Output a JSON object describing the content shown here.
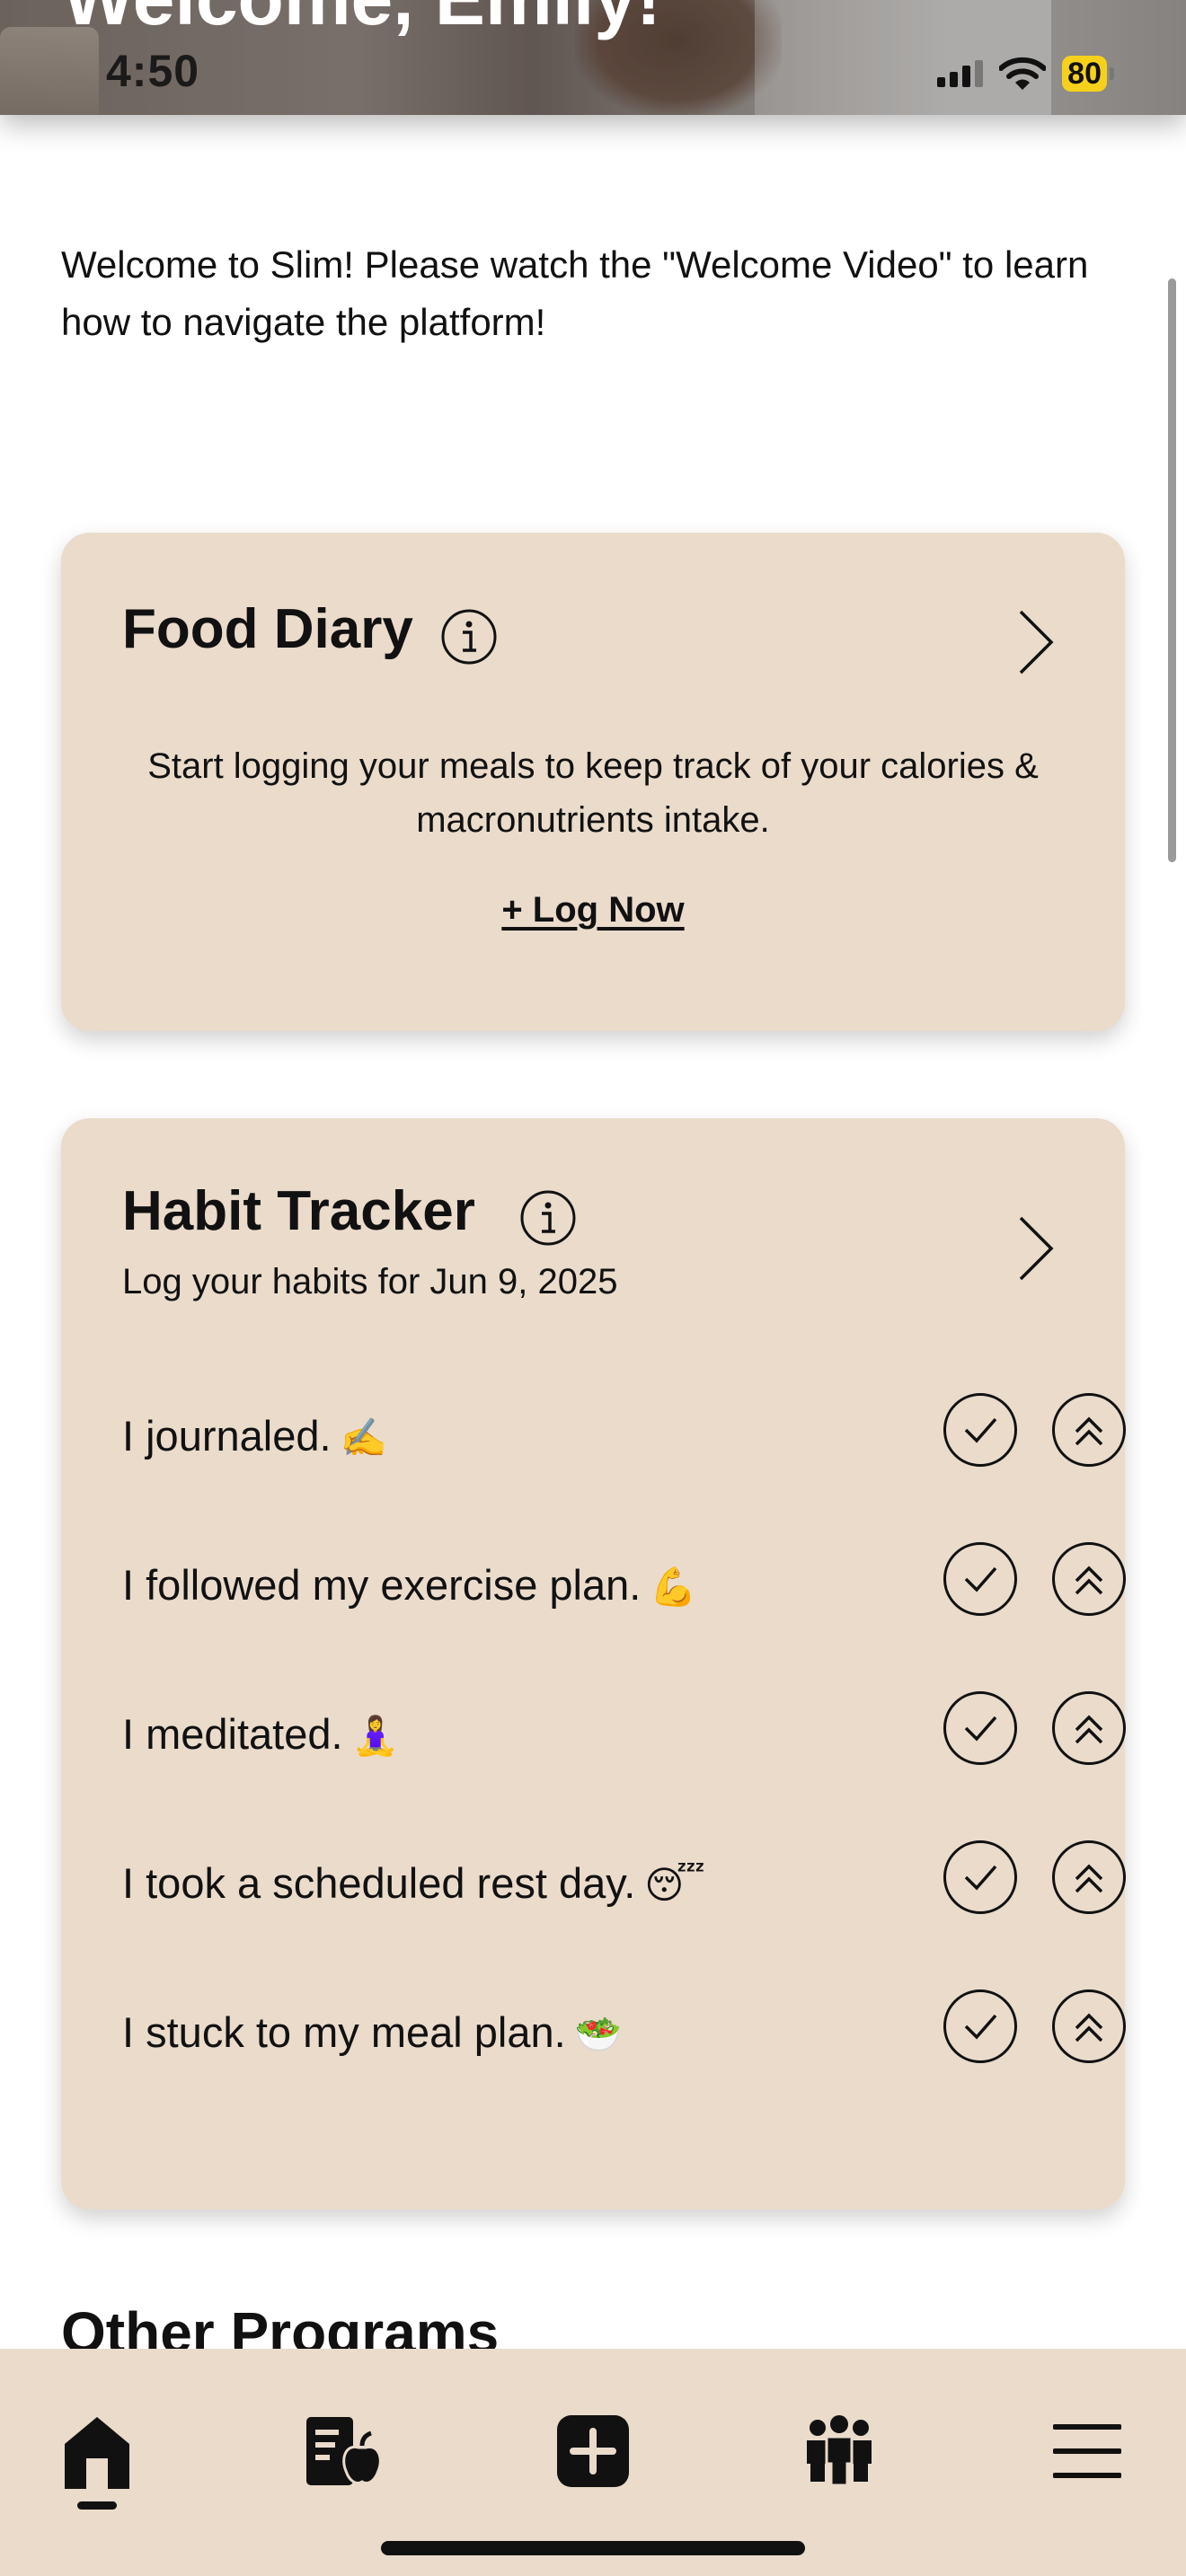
{
  "header": {
    "greeting": "Welcome, Emily!",
    "status": {
      "time": "4:50",
      "battery": "80"
    }
  },
  "intro": {
    "text": "Welcome to Slim! Please watch the \"Welcome Video\" to learn how to navigate the platform!"
  },
  "food_diary": {
    "title": "Food Diary",
    "description": "Start logging your meals to keep track of your calories & macronutrients intake.",
    "log_now": "+ Log Now"
  },
  "habit_tracker": {
    "title": "Habit Tracker",
    "subtitle": "Log your habits for Jun 9, 2025",
    "habits": [
      {
        "text": "I journaled.",
        "emoji": "✍️"
      },
      {
        "text": "I followed my exercise plan.",
        "emoji": "💪"
      },
      {
        "text": "I meditated.",
        "emoji": "🧘‍♀️"
      },
      {
        "text": "I took a scheduled rest day.",
        "emoji": "😴"
      },
      {
        "text": "I stuck to my meal plan.",
        "emoji": "🥗"
      }
    ]
  },
  "other_programs": {
    "title": "Other Programs"
  },
  "nav": {
    "items": [
      {
        "icon": "home-icon",
        "active": true
      },
      {
        "icon": "nutrition-icon",
        "active": false
      },
      {
        "icon": "add-icon",
        "active": false
      },
      {
        "icon": "community-icon",
        "active": false
      },
      {
        "icon": "menu-icon",
        "active": false
      }
    ]
  },
  "colors": {
    "card_background": "#eadbcb",
    "battery": "#f6d11c",
    "text": "#111111"
  }
}
